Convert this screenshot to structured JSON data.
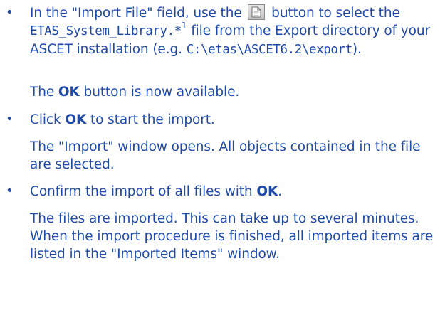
{
  "step1": {
    "pre": "In the \"Import File\" field, use the",
    "icon": "open-file-icon",
    "mid": "button to select the",
    "filename": "ETAS_System_Library.*",
    "footnote": "1",
    "post1": "file from the Export directory of your ASCET installation (e.g.",
    "path": "C:\\etas\\ASCET6.2\\export",
    "post2": ").",
    "result_pre": "The",
    "result_bold": "OK",
    "result_post": "button is now available."
  },
  "step2": {
    "pre": "Click",
    "bold": "OK",
    "post": "to start the import.",
    "result": "The \"Import\" window opens. All objects contained in the file are selected."
  },
  "step3": {
    "pre": "Confirm the import of all files with",
    "bold": "OK",
    "post": ".",
    "result": "The files are imported. This can take up to several minutes. When the import procedure is finished, all imported items are listed in the \"Imported Items\" window."
  },
  "bullet_char": "•"
}
